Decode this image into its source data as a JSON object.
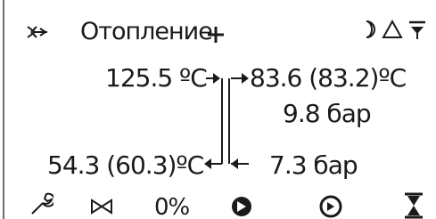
{
  "header": {
    "title": "Отопление",
    "icons": [
      "shuffle-icon",
      "plus-icon",
      "moon-icon",
      "alarm-triangle-icon",
      "filter-icon"
    ]
  },
  "flow": {
    "supply_temp": "125.5 ºC",
    "return_temp": "54.3 (60.3)ºC",
    "out_temp": "83.6 (83.2)ºC",
    "out_pressure": "9.8 бар",
    "in_pressure": "7.3 бар"
  },
  "footer": {
    "valve_percent": "0%",
    "icons": [
      "wrench-icon",
      "valve-icon",
      "pump-icon",
      "pump-icon",
      "hourglass-icon"
    ]
  }
}
